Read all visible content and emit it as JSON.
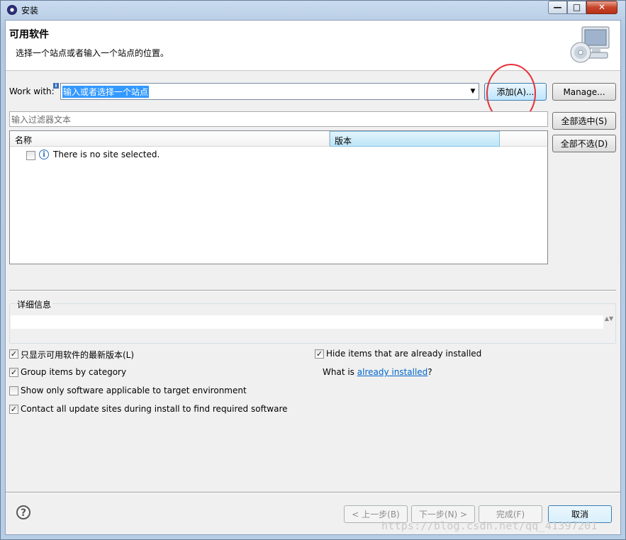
{
  "window": {
    "title": "安装"
  },
  "header": {
    "title": "可用软件",
    "description": "选择一个站点或者输入一个站点的位置。"
  },
  "site": {
    "label": "Work with:",
    "value": "输入或者选择一个站点",
    "add_button": "添加(A)...",
    "manage_button": "Manage..."
  },
  "filter": {
    "placeholder": "输入过滤器文本"
  },
  "selection": {
    "select_all": "全部选中(S)",
    "deselect_all": "全部不选(D)"
  },
  "table": {
    "columns": [
      "名称",
      "版本"
    ],
    "rows": [
      {
        "name": "There is no site selected.",
        "checked": false,
        "icon": "info-icon"
      }
    ]
  },
  "details": {
    "label": "详细信息"
  },
  "options": [
    {
      "label": "只显示可用软件的最新版本(L)",
      "checked": true,
      "check_glyph": "✓"
    },
    {
      "label": "Group items by category",
      "checked": true,
      "check_glyph": "✓"
    },
    {
      "label": "Show only software applicable to target environment",
      "checked": false,
      "check_glyph": ""
    },
    {
      "label": "Contact all update sites during install to find required software",
      "checked": true,
      "check_glyph": "✓"
    },
    {
      "label": "Hide items that are already installed",
      "checked": true,
      "check_glyph": "✓"
    }
  ],
  "installed": {
    "prefix": "What is ",
    "link": "already installed",
    "suffix": "?"
  },
  "footer": {
    "help": "?",
    "back": "< 上一步(B)",
    "next": "下一步(N) >",
    "finish": "完成(F)",
    "cancel": "取消"
  },
  "watermark": "https://blog.csdn.net/qq_41397201",
  "captions": {
    "minimize": "—",
    "maximize": "□",
    "close": "✕",
    "combo_arrow": "▼",
    "info_mark": "i",
    "row_icon": "i",
    "scroll": "▲▼"
  },
  "colors": {
    "selection": "#3399ff",
    "highlight_circle": "#e8303a",
    "link": "#0066cc"
  }
}
